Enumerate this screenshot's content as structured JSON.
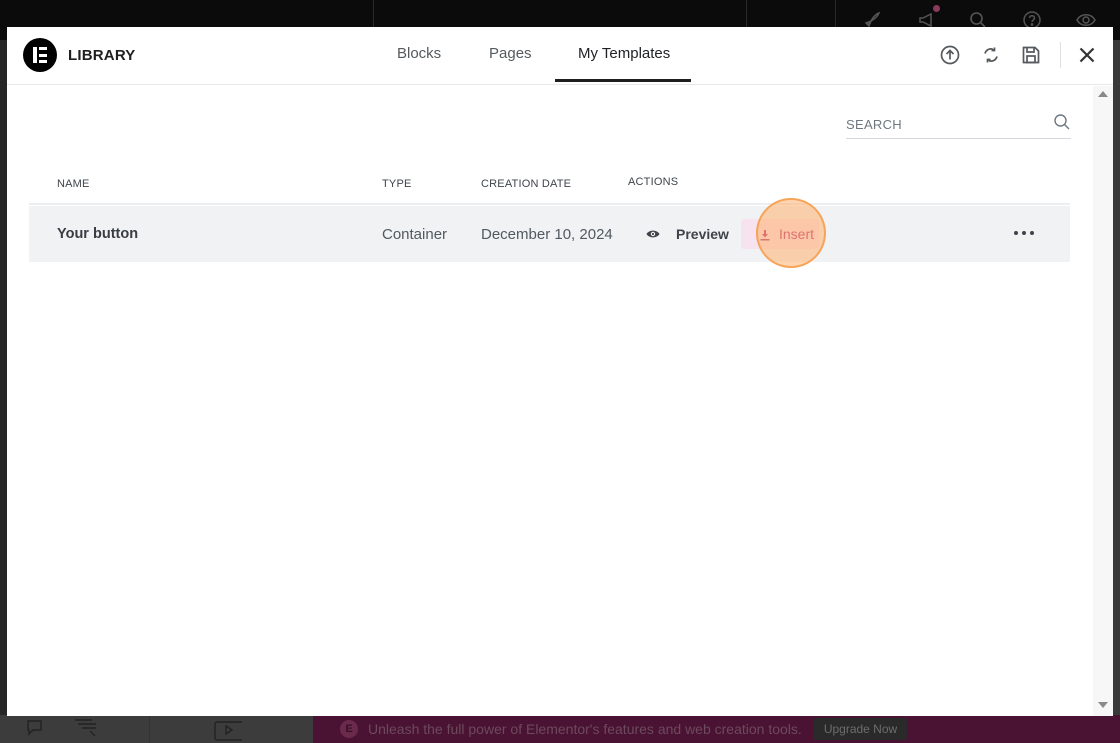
{
  "modal": {
    "title": "LIBRARY",
    "tabs": [
      {
        "label": "Blocks"
      },
      {
        "label": "Pages"
      },
      {
        "label": "My Templates",
        "active": true
      }
    ],
    "header_icons": [
      "upload-icon",
      "sync-icon",
      "save-icon",
      "close-icon"
    ]
  },
  "search": {
    "placeholder": "SEARCH",
    "value": ""
  },
  "table": {
    "columns": [
      "NAME",
      "TYPE",
      "CREATION DATE",
      "ACTIONS"
    ],
    "rows": [
      {
        "name": "Your button",
        "type": "Container",
        "creation_date": "December 10, 2024",
        "preview_label": "Preview",
        "insert_label": "Insert"
      }
    ]
  },
  "banner": {
    "text": "Unleash the full power of Elementor's features and web creation tools.",
    "button_label": "Upgrade Now"
  },
  "colors": {
    "accent": "#b5296f",
    "insert_bg": "#f7e3ef",
    "highlight": "#ffb06e"
  }
}
